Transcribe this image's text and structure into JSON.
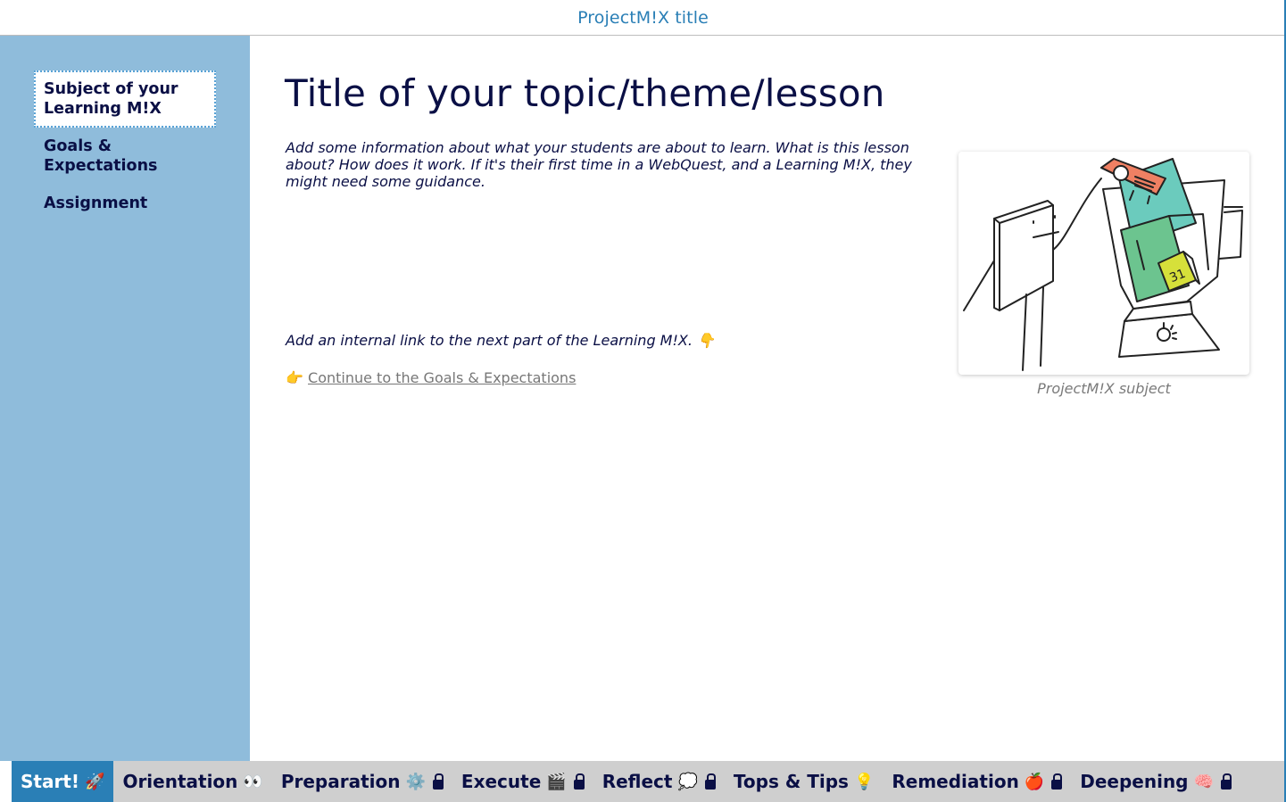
{
  "header": {
    "site_title": "ProjectM!X title"
  },
  "sidebar": {
    "items": [
      {
        "label": "Subject of your Learning M!X",
        "active": true
      },
      {
        "label": "Goals & Expectations",
        "active": false
      },
      {
        "label": "Assignment",
        "active": false
      }
    ]
  },
  "main": {
    "title": "Title of your topic/theme/lesson",
    "intro": "Add some information about what your students are about to learn. What is this lesson about? How does it work. If it's their first time in a WebQuest, and a Learning M!X, they might need some guidance.",
    "link_hint": "Add an internal link to the next part of the Learning M!X.",
    "link_hint_emoji": "👇",
    "continue_emoji": "👉",
    "continue_link": "Continue to the Goals & Expectations",
    "figure_caption": "ProjectM!X subject",
    "figure_alt": "illustration of a board character putting a projector, books, folder and calendar into a blender"
  },
  "bottom_nav": {
    "tabs": [
      {
        "label": "Start!",
        "emoji": "🚀",
        "locked": false,
        "active": true
      },
      {
        "label": "Orientation",
        "emoji": "👀",
        "locked": false,
        "active": false
      },
      {
        "label": "Preparation",
        "emoji": "⚙️",
        "locked": true,
        "active": false
      },
      {
        "label": "Execute",
        "emoji": "🎬",
        "locked": true,
        "active": false
      },
      {
        "label": "Reflect",
        "emoji": "💭",
        "locked": true,
        "active": false
      },
      {
        "label": "Tops & Tips",
        "emoji": "💡",
        "locked": false,
        "active": false
      },
      {
        "label": "Remediation",
        "emoji": "🍎",
        "locked": true,
        "active": false
      },
      {
        "label": "Deepening",
        "emoji": "🧠",
        "locked": true,
        "active": false
      }
    ]
  },
  "colors": {
    "accent": "#2a7fb6",
    "sidebar_bg": "#8fbcdb",
    "text_dark": "#0a0f45",
    "nav_bg": "#cfcfcf",
    "link_gray": "#777777"
  }
}
